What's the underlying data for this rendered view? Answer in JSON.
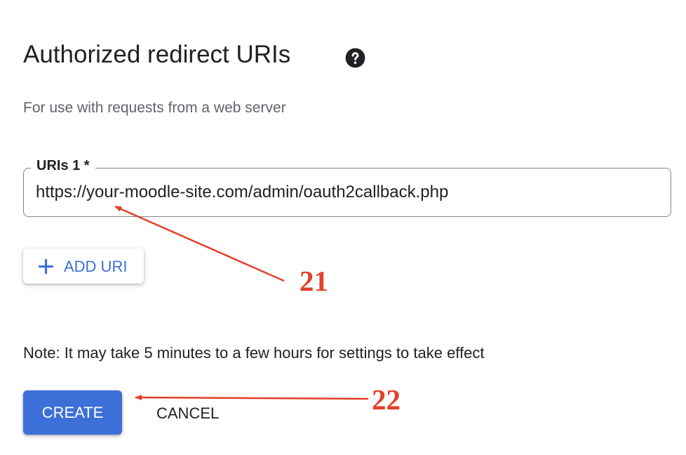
{
  "section": {
    "title": "Authorized redirect URIs",
    "help_icon": "help-circle-icon",
    "subtitle": "For use with requests from a web server"
  },
  "uri_field": {
    "label": "URIs 1 *",
    "value": "https://your-moodle-site.com/admin/oauth2callback.php"
  },
  "add_uri_button": {
    "icon": "plus-icon",
    "label": "ADD URI"
  },
  "note": "Note: It may take 5 minutes to a few hours for settings to take effect",
  "actions": {
    "create_label": "CREATE",
    "cancel_label": "CANCEL"
  },
  "annotations": {
    "step_21": "21",
    "step_22": "22",
    "color": "#e2402a"
  },
  "colors": {
    "primary": "#3c6fd8",
    "text": "#202124",
    "secondary_text": "#5f6368",
    "border": "#80868b"
  }
}
